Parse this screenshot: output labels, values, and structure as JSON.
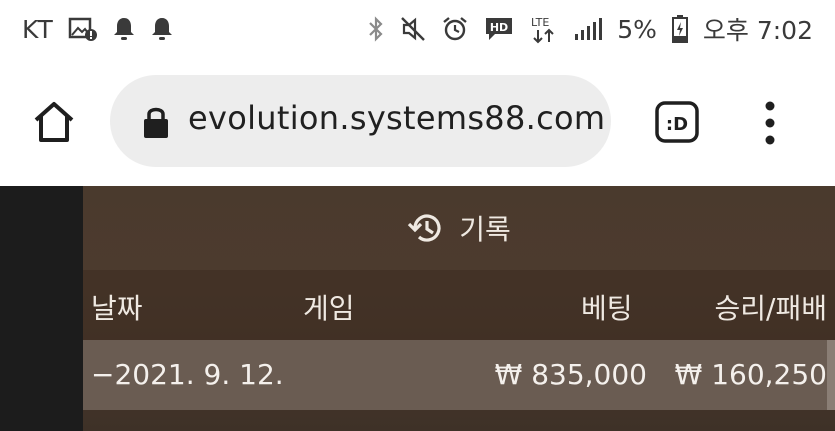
{
  "status_bar": {
    "carrier": "KT",
    "battery_text": "5%",
    "time": "오후 7:02",
    "network_text": "LTE",
    "hd_text": "HD"
  },
  "browser": {
    "url": "evolution.systems88.com",
    "extension_label": ":D"
  },
  "history": {
    "title": "기록",
    "columns": [
      "날짜",
      "게임",
      "베팅",
      "승리/패배"
    ],
    "rows": [
      {
        "date": "−2021. 9. 12.",
        "game": "",
        "bet": "₩ 835,000",
        "win_loss": "₩ 160,250"
      }
    ]
  }
}
